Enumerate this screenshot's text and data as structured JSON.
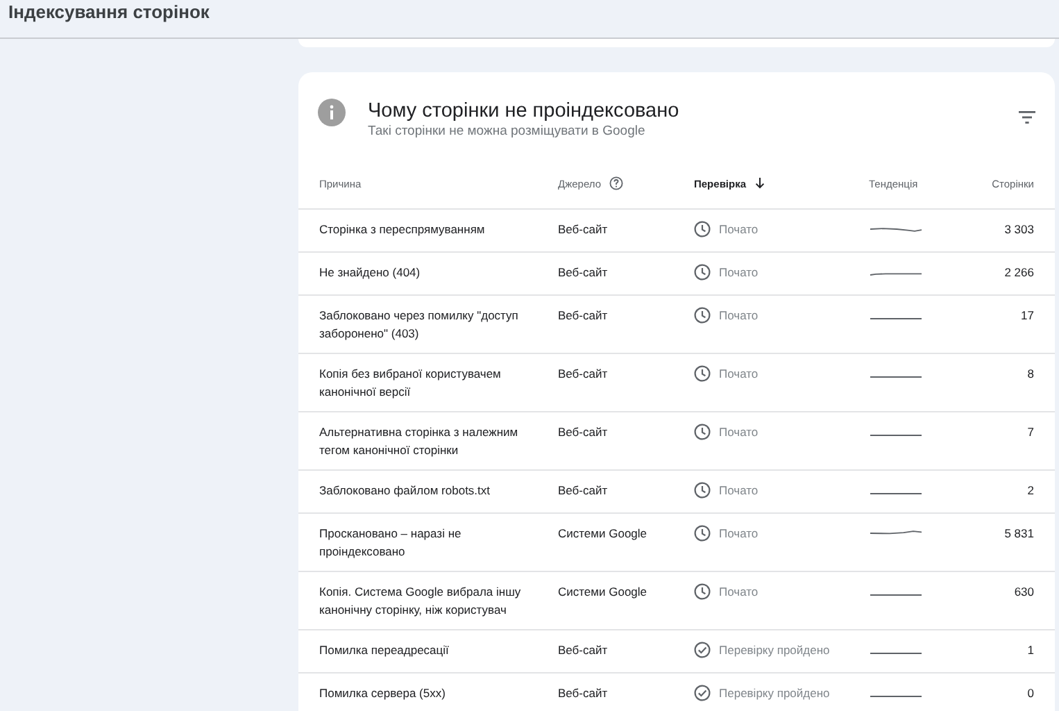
{
  "header": {
    "title": "Індексування сторінок"
  },
  "card": {
    "title": "Чому сторінки не проіндексовано",
    "subtitle": "Такі сторінки не можна розміщувати в Google"
  },
  "table": {
    "columns": [
      {
        "label": "Причина",
        "kind": "plain"
      },
      {
        "label": "Джерело",
        "kind": "help"
      },
      {
        "label": "Перевірка",
        "kind": "sorted"
      },
      {
        "label": "Тенденція",
        "kind": "plain"
      },
      {
        "label": "Сторінки",
        "kind": "right"
      }
    ],
    "rows": [
      {
        "reason": "Сторінка з переспрямуванням",
        "source": "Веб-сайт",
        "status": "Почато",
        "kind": "started",
        "pages": "3 303"
      },
      {
        "reason": "Не знайдено (404)",
        "source": "Веб-сайт",
        "status": "Почато",
        "kind": "started",
        "pages": "2 266"
      },
      {
        "reason": "Заблоковано через помилку \"доступ заборонено\" (403)",
        "source": "Веб-сайт",
        "status": "Почато",
        "kind": "started",
        "pages": "17"
      },
      {
        "reason": "Копія без вибраної користувачем канонічної версії",
        "source": "Веб-сайт",
        "status": "Почато",
        "kind": "started",
        "pages": "8"
      },
      {
        "reason": "Альтернативна сторінка з належним тегом канонічної сторінки",
        "source": "Веб-сайт",
        "status": "Почато",
        "kind": "started",
        "pages": "7"
      },
      {
        "reason": "Заблоковано файлом robots.txt",
        "source": "Веб-сайт",
        "status": "Почато",
        "kind": "started",
        "pages": "2"
      },
      {
        "reason": "Проскановано – наразі не проіндексовано",
        "source": "Системи Google",
        "status": "Почато",
        "kind": "started",
        "pages": "5 831"
      },
      {
        "reason": "Копія. Система Google вибрала іншу канонічну сторінку, ніж користувач",
        "source": "Системи Google",
        "status": "Почато",
        "kind": "started",
        "pages": "630"
      },
      {
        "reason": "Помилка переадресації",
        "source": "Веб-сайт",
        "status": "Перевірку пройдено",
        "kind": "passed",
        "pages": "1"
      },
      {
        "reason": "Помилка сервера (5xx)",
        "source": "Веб-сайт",
        "status": "Перевірку пройдено",
        "kind": "passed",
        "pages": "0"
      }
    ]
  }
}
